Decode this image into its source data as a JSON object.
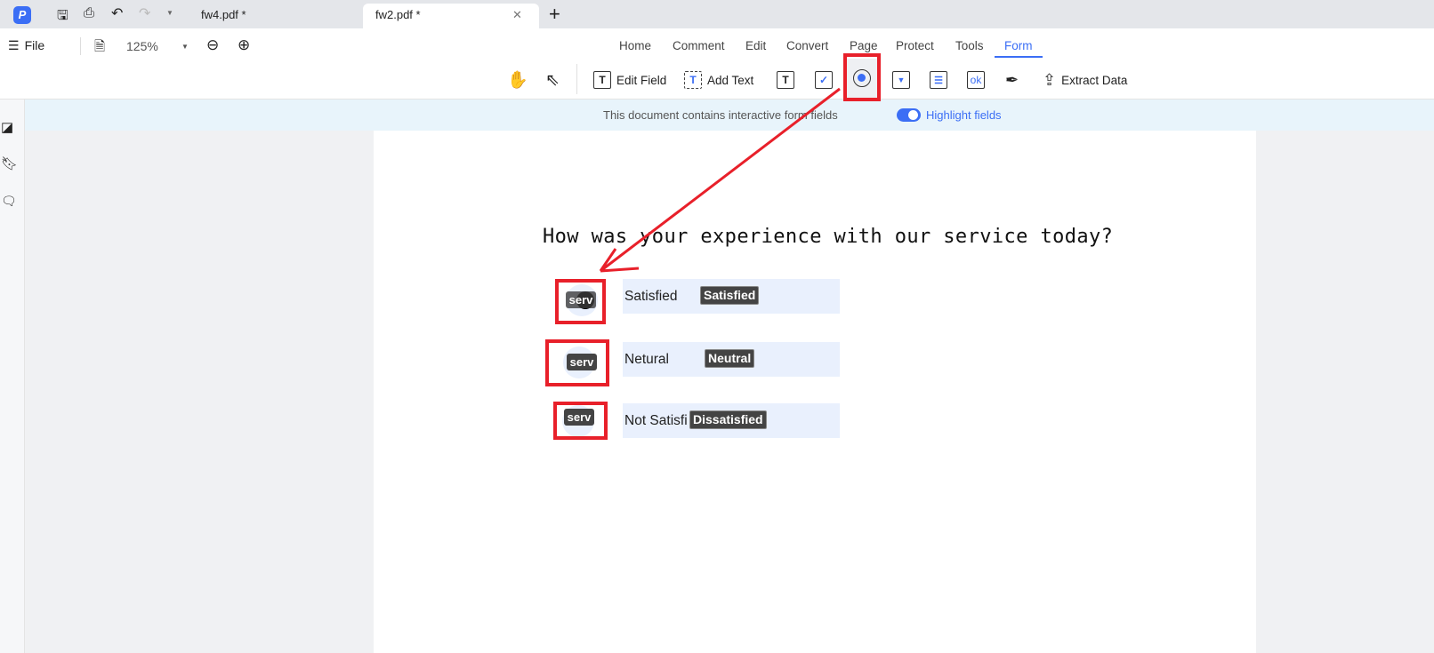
{
  "tabs": [
    {
      "label": "fw4.pdf *"
    },
    {
      "label": "fw2.pdf *"
    }
  ],
  "toolbar": {
    "file": "File",
    "zoom": "125%"
  },
  "menu": [
    "Home",
    "Comment",
    "Edit",
    "Convert",
    "Page",
    "Protect",
    "Tools",
    "Form"
  ],
  "form_tools": {
    "edit_field": "Edit Field",
    "add_text": "Add Text",
    "extract_data": "Extract Data",
    "combo_ok": "ok"
  },
  "banner": {
    "message": "This document contains interactive form fields",
    "highlight": "Highlight fields"
  },
  "document": {
    "question": "How was your experience with our service today?",
    "options": [
      {
        "label": "Satisfied",
        "value": "Satisfied",
        "field": "serv"
      },
      {
        "label": "Netural",
        "value": "Neutral",
        "field": "serv"
      },
      {
        "label": "Not Satisfi",
        "value": "Dissatisfied",
        "field": "serv"
      }
    ]
  },
  "colors": {
    "accent": "#3b6ef5",
    "annotation": "#e8202a"
  }
}
